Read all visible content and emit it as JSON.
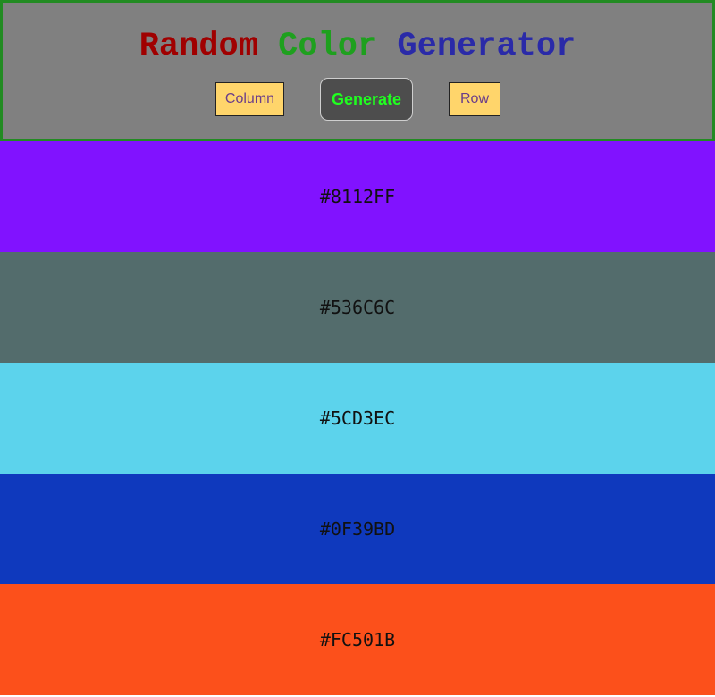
{
  "header": {
    "title_words": [
      {
        "text": "Random",
        "color": "#a00000"
      },
      {
        "text": "Color",
        "color": "#1ea01e"
      },
      {
        "text": "Generator",
        "color": "#2a2aa8"
      }
    ],
    "background_color": "#808080",
    "border_color": "#228b22"
  },
  "controls": {
    "column_label": "Column",
    "generate_label": "Generate",
    "row_label": "Row"
  },
  "swatches": [
    {
      "hex": "#8112FF"
    },
    {
      "hex": "#536C6C"
    },
    {
      "hex": "#5CD3EC"
    },
    {
      "hex": "#0F39BD"
    },
    {
      "hex": "#FC501B"
    }
  ]
}
